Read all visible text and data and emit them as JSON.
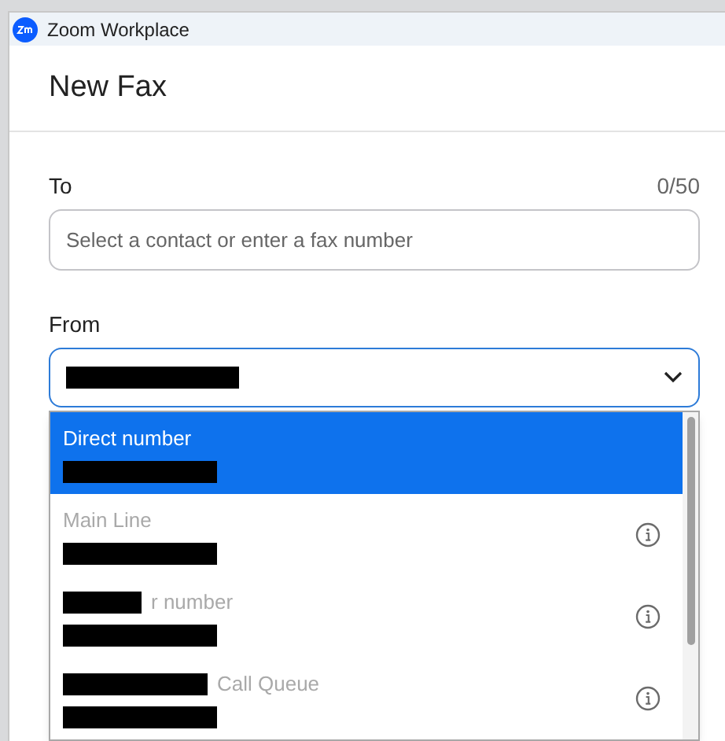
{
  "window": {
    "title": "Zoom Workplace"
  },
  "dialog": {
    "title": "New Fax"
  },
  "to": {
    "label": "To",
    "counter": "0/50",
    "placeholder": "Select a contact or enter a fax number"
  },
  "from": {
    "label": "From",
    "expanded": true
  },
  "options": [
    {
      "label": "Direct number",
      "label_redacted": false,
      "selected": true,
      "disabled": false,
      "info": false
    },
    {
      "label": "Main Line",
      "label_redacted": false,
      "selected": false,
      "disabled": true,
      "info": true
    },
    {
      "label": "r number",
      "label_redacted": true,
      "selected": false,
      "disabled": true,
      "info": true
    },
    {
      "label": "Call Queue",
      "label_redacted": true,
      "selected": false,
      "disabled": true,
      "info": true
    }
  ]
}
